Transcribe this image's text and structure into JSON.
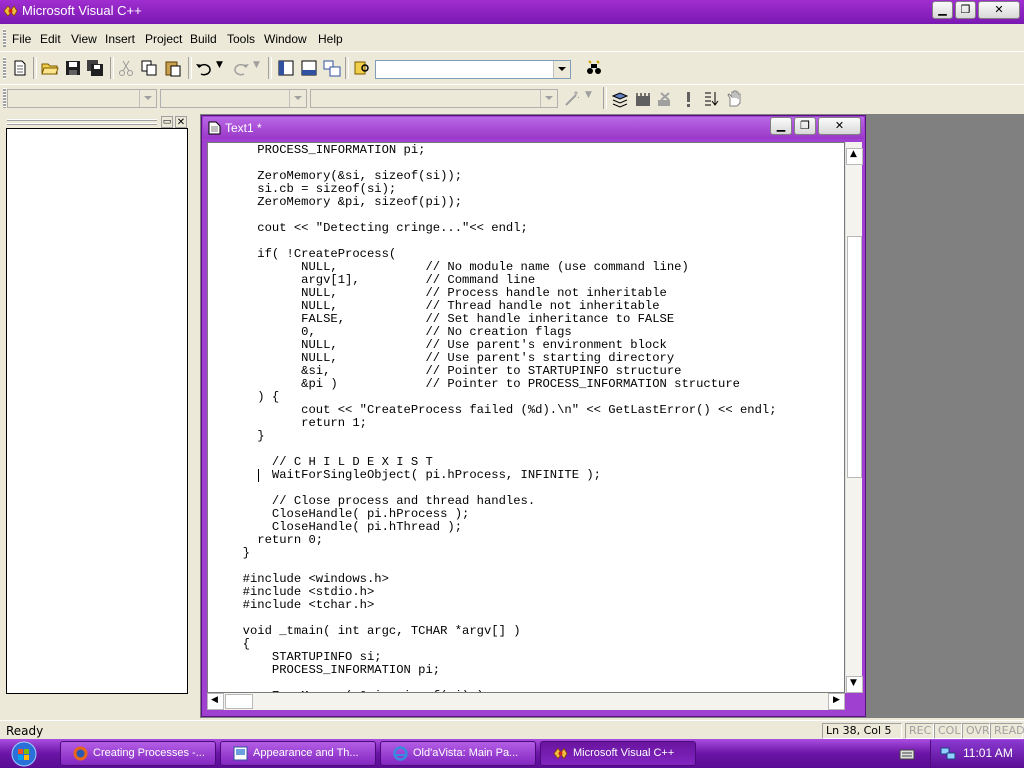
{
  "app": {
    "title": "Microsoft Visual C++"
  },
  "menu": [
    "File",
    "Edit",
    "View",
    "Insert",
    "Project",
    "Build",
    "Tools",
    "Window",
    "Help"
  ],
  "child_window": {
    "title": "Text1 *"
  },
  "code_lines": [
    "    PROCESS_INFORMATION pi;",
    "",
    "    ZeroMemory(&si, sizeof(si));",
    "    si.cb = sizeof(si);",
    "    ZeroMemory &pi, sizeof(pi));",
    "",
    "    cout << \"Detecting cringe...\"<< endl;",
    "",
    "    if( !CreateProcess(",
    "          NULL,            // No module name (use command line)",
    "          argv[1],         // Command line",
    "          NULL,            // Process handle not inheritable",
    "          NULL,            // Thread handle not inheritable",
    "          FALSE,           // Set handle inheritance to FALSE",
    "          0,               // No creation flags",
    "          NULL,            // Use parent's environment block",
    "          NULL,            // Use parent's starting directory",
    "          &si,             // Pointer to STARTUPINFO structure",
    "          &pi )            // Pointer to PROCESS_INFORMATION structure",
    "    ) {",
    "          cout << \"CreateProcess failed (%d).\\n\" << GetLastError() << endl;",
    "          return 1;",
    "    }",
    "",
    "      // C H I L D E X I S T",
    "      WaitForSingleObject( pi.hProcess, INFINITE );",
    "",
    "      // Close process and thread handles.",
    "      CloseHandle( pi.hProcess );",
    "      CloseHandle( pi.hThread );",
    "    return 0;",
    "  }",
    "",
    "  #include <windows.h>",
    "  #include <stdio.h>",
    "  #include <tchar.h>",
    "",
    "  void _tmain( int argc, TCHAR *argv[] )",
    "  {",
    "      STARTUPINFO si;",
    "      PROCESS_INFORMATION pi;",
    "",
    "      ZeroMemory( &si, sizeof(si) );"
  ],
  "status": {
    "text": "Ready",
    "position": "Ln 38, Col 5",
    "indicators": [
      "REC",
      "COL",
      "OVR",
      "READ"
    ]
  },
  "taskbar": {
    "tasks": [
      {
        "label": "Creating Processes -...",
        "icon": "firefox-icon"
      },
      {
        "label": "Appearance and Th...",
        "icon": "control-panel-icon"
      },
      {
        "label": "Old'aVista: Main Pa...",
        "icon": "ie-icon"
      },
      {
        "label": "Microsoft Visual C++",
        "icon": "visual-cpp-icon"
      }
    ],
    "clock": "11:01 AM"
  },
  "colors": {
    "theme": "#8a2fc4",
    "taskbar": "#6b14a6"
  }
}
